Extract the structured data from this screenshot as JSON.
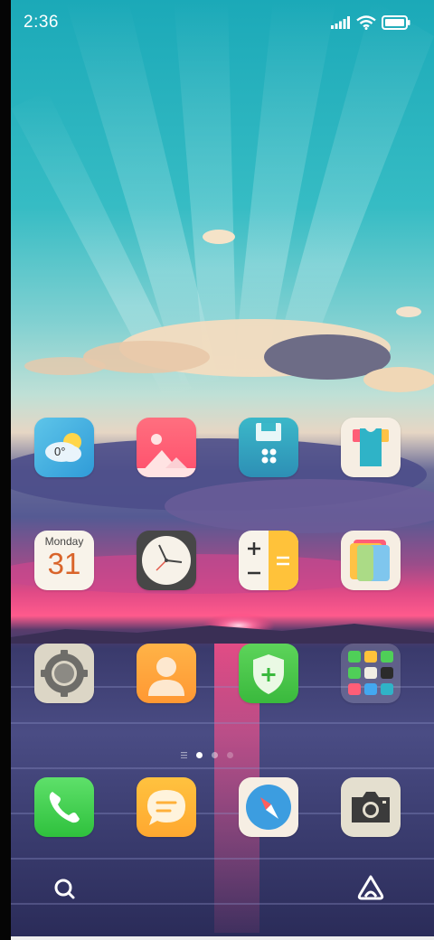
{
  "status_bar": {
    "time": "2:36",
    "icons": [
      "signal-icon",
      "wifi-icon",
      "battery-icon"
    ]
  },
  "home_screen": {
    "rows": [
      [
        {
          "name": "weather-app-icon",
          "temperature": "0°"
        },
        {
          "name": "gallery-app-icon"
        },
        {
          "name": "file-manager-app-icon"
        },
        {
          "name": "themes-app-icon"
        }
      ],
      [
        {
          "name": "calendar-app-icon",
          "weekday": "Monday",
          "date": "31"
        },
        {
          "name": "clock-app-icon"
        },
        {
          "name": "calculator-app-icon"
        },
        {
          "name": "notes-app-icon"
        }
      ],
      [
        {
          "name": "settings-app-icon"
        },
        {
          "name": "contacts-app-icon"
        },
        {
          "name": "security-app-icon"
        },
        {
          "name": "app-folder"
        }
      ]
    ],
    "page_indicator": {
      "pages": 2,
      "active": 1
    }
  },
  "dock": [
    "phone-app-icon",
    "messages-app-icon",
    "browser-app-icon",
    "camera-app-icon"
  ],
  "bottom_bar": [
    "search-icon",
    "assistant-icon"
  ],
  "colors": {
    "sky_top": "#1aa9b8",
    "sunset_pink": "#ff3d7a",
    "water": "#3d3f6e"
  }
}
